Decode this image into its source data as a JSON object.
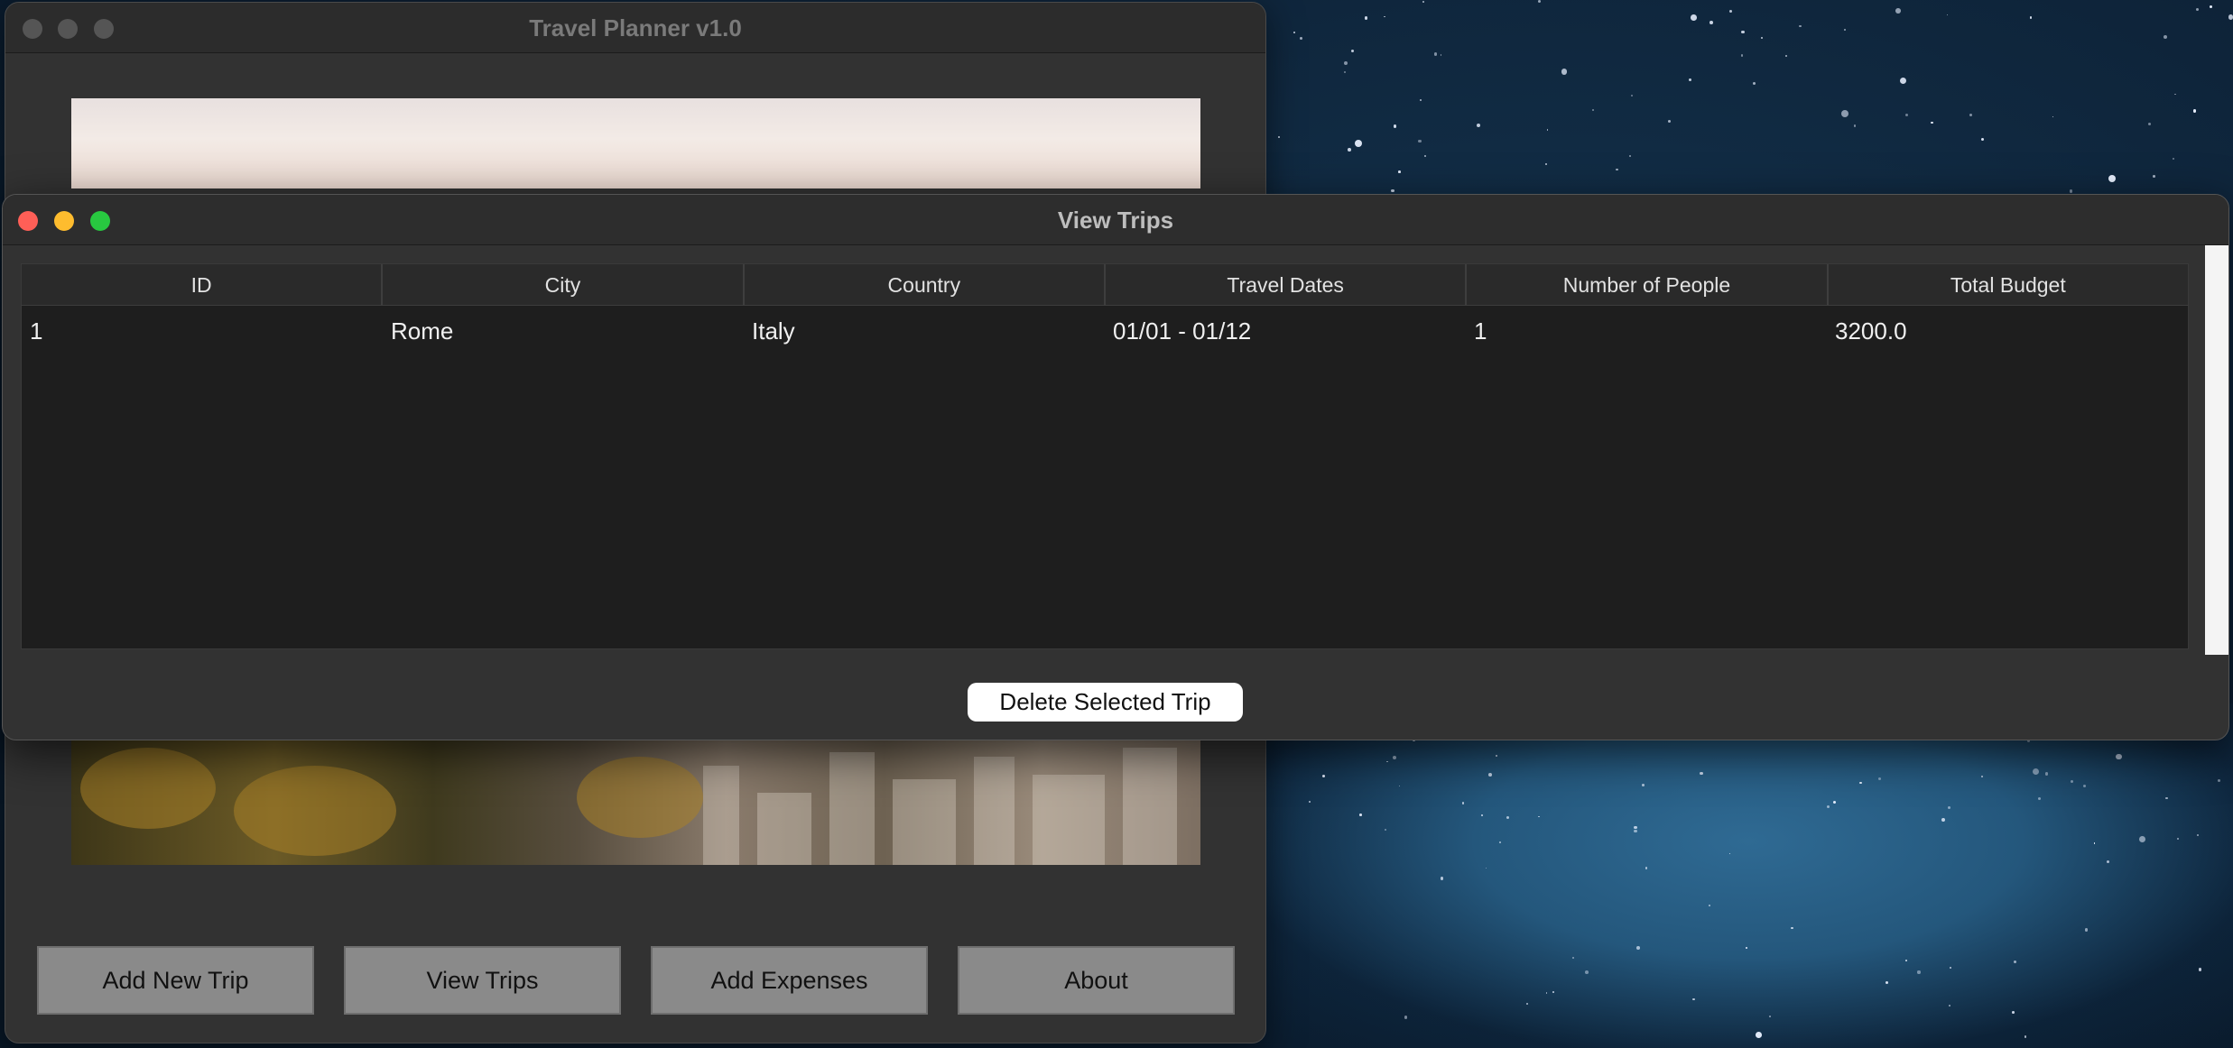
{
  "main_window": {
    "title": "Travel Planner v1.0",
    "buttons": [
      "Add New Trip",
      "View Trips",
      "Add Expenses",
      "About"
    ]
  },
  "dialog": {
    "title": "View Trips",
    "columns": [
      "ID",
      "City",
      "Country",
      "Travel Dates",
      "Number of People",
      "Total Budget"
    ],
    "rows": [
      [
        "1",
        "Rome",
        "Italy",
        "01/01 - 01/12",
        "1",
        "3200.0"
      ]
    ],
    "delete_button": "Delete Selected Trip"
  },
  "colors": {
    "close": "#ff5f57",
    "minimize": "#febc2e",
    "zoom": "#28c840",
    "window_bg": "#323232",
    "table_bg": "#1e1e1e"
  },
  "icons": [
    "close-icon",
    "minimize-icon",
    "zoom-icon"
  ]
}
